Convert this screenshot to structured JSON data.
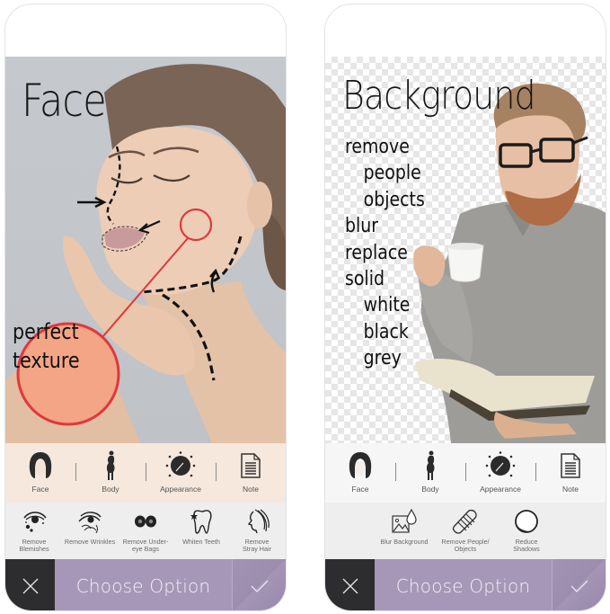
{
  "screens": [
    {
      "id": "face",
      "headline": "Face",
      "annotation_label": [
        "perfect",
        "texture"
      ],
      "categories": [
        {
          "label": "Face",
          "icon": "face-icon"
        },
        {
          "label": "Body",
          "icon": "body-icon"
        },
        {
          "label": "Appearance",
          "icon": "appearance-dial-icon"
        },
        {
          "label": "Note",
          "icon": "note-icon"
        }
      ],
      "tools": [
        {
          "label": "Remove\nBlemishes",
          "icon": "blemish-eye-icon"
        },
        {
          "label": "Remove Wrinkles",
          "icon": "wrinkle-eye-icon"
        },
        {
          "label": "Remove Under-\neye Bags",
          "icon": "eye-bags-icon"
        },
        {
          "label": "Whiten Teeth",
          "icon": "tooth-icon"
        },
        {
          "label": "Remove\nStray Hair",
          "icon": "hair-icon"
        }
      ],
      "action_bar": {
        "cancel_icon": "close-icon",
        "label": "Choose Option",
        "confirm_icon": "check-icon"
      }
    },
    {
      "id": "background",
      "headline": "Background",
      "feature_list": [
        {
          "text": "remove",
          "indent": false
        },
        {
          "text": "people",
          "indent": true
        },
        {
          "text": "objects",
          "indent": true
        },
        {
          "text": "blur",
          "indent": false
        },
        {
          "text": "replace",
          "indent": false
        },
        {
          "text": "solid",
          "indent": false
        },
        {
          "text": "white",
          "indent": true
        },
        {
          "text": "black",
          "indent": true
        },
        {
          "text": "grey",
          "indent": true
        }
      ],
      "categories": [
        {
          "label": "Face",
          "icon": "face-icon"
        },
        {
          "label": "Body",
          "icon": "body-icon"
        },
        {
          "label": "Appearance",
          "icon": "appearance-dial-icon"
        },
        {
          "label": "Note",
          "icon": "note-icon"
        }
      ],
      "tools": [
        {
          "label": "Blur Background",
          "icon": "blur-background-icon"
        },
        {
          "label": "Remove People/\nObjects",
          "icon": "eraser-icon"
        },
        {
          "label": "Reduce\nShadows",
          "icon": "shadow-sphere-icon"
        }
      ],
      "action_bar": {
        "cancel_icon": "close-icon",
        "label": "Choose Option",
        "confirm_icon": "check-icon"
      }
    }
  ],
  "colors": {
    "action_purple": "#a697b8",
    "cancel_dark": "#2d2c2f",
    "annotation_red": "#e0383c"
  }
}
